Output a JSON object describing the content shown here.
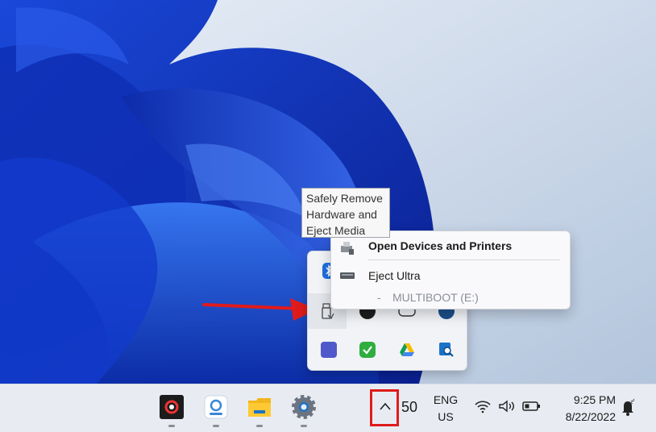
{
  "tooltip": {
    "line1": "Safely Remove",
    "line2": "Hardware and",
    "line3": "Eject Media"
  },
  "context_menu": {
    "open_devices_label": "Open Devices and Printers",
    "eject_label": "Eject Ultra",
    "sub_dash": "-",
    "sub_label": "MULTIBOOT (E:)"
  },
  "taskbar": {
    "tray_count": "50",
    "language": "ENG",
    "region": "US",
    "time": "9:25 PM",
    "date": "8/22/2022"
  },
  "colors": {
    "highlight": "#e01b1b",
    "arrow": "#e01b1b",
    "taskbar_bg": "#e8ecf2",
    "flyout_bg": "#f1f3f7"
  },
  "icons": {
    "tray": [
      "bluetooth-icon",
      "usb-drive-icon",
      "black-circle-app-icon",
      "game-controller-icon",
      "steam-icon",
      "teams-icon",
      "green-check-icon",
      "google-drive-icon",
      "search-app-icon"
    ],
    "taskbar_apps": [
      "recorder-icon",
      "photos-icon",
      "file-explorer-icon",
      "settings-icon"
    ]
  }
}
